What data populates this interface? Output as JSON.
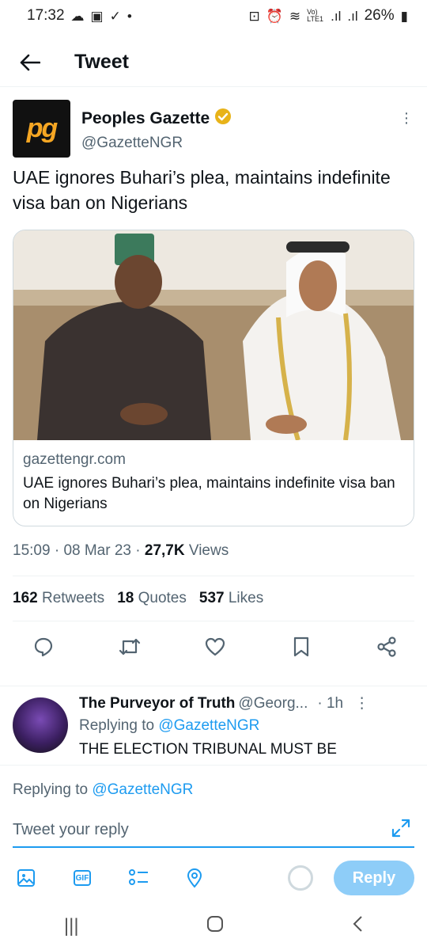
{
  "status_bar": {
    "time": "17:32",
    "battery": "26%",
    "network_label": "Vo) LTE1"
  },
  "header": {
    "title": "Tweet"
  },
  "tweet": {
    "author_name": "Peoples Gazette",
    "author_handle": "@GazetteNGR",
    "avatar_text": "pg",
    "text": "UAE ignores Buhari’s plea, maintains indefinite visa ban on Nigerians",
    "card": {
      "domain": "gazettengr.com",
      "title": "UAE ignores Buhari’s plea, maintains indefinite visa ban on Nigerians"
    },
    "time": "15:09",
    "date": "08 Mar 23",
    "views_count": "27,7K",
    "views_label": "Views",
    "retweets_count": "162",
    "retweets_label": "Retweets",
    "quotes_count": "18",
    "quotes_label": "Quotes",
    "likes_count": "537",
    "likes_label": "Likes"
  },
  "reply": {
    "name": "The Purveyor of Truth",
    "handle": "@Georg...",
    "time": "· 1h",
    "replying_prefix": "Replying to",
    "replying_handle": "@GazetteNGR",
    "text": "THE ELECTION TRIBUNAL MUST BE"
  },
  "compose": {
    "replying_prefix": "Replying to",
    "replying_handle": "@GazetteNGR",
    "placeholder": "Tweet your reply",
    "gif_label": "GIF",
    "reply_button": "Reply"
  },
  "colors": {
    "accent": "#1d9bf0",
    "accent_disabled": "#8ecdf8",
    "verified": "#e8b319",
    "brand_orange": "#f5a623"
  }
}
